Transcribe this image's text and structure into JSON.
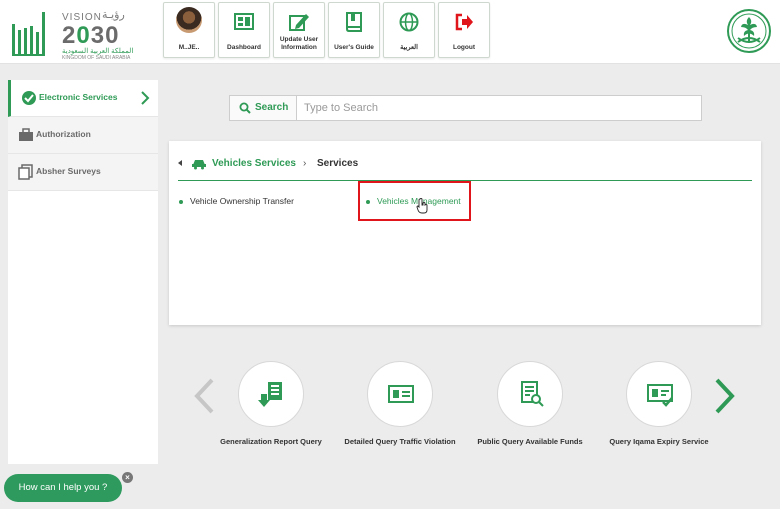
{
  "header": {
    "logo": {
      "vision": "VISION",
      "vision_ar": "رؤيـة",
      "year_a": "2",
      "year_b": "0",
      "year_c": "30",
      "kingdom_ar": "المملكة العربية السعودية",
      "kingdom": "KINGDOM OF SAUDI ARABIA"
    },
    "nav": [
      {
        "label": "M..JE..",
        "icon": "avatar"
      },
      {
        "label": "Dashboard",
        "icon": "dashboard-icon"
      },
      {
        "label_line1": "Update User",
        "label_line2": "Information",
        "icon": "edit-icon"
      },
      {
        "label": "User's Guide",
        "icon": "book-icon"
      },
      {
        "label": "العربية",
        "icon": "globe-icon"
      },
      {
        "label": "Logout",
        "icon": "logout-icon"
      }
    ]
  },
  "sidebar": {
    "items": [
      {
        "label": "Electronic Services",
        "icon": "services-icon",
        "active": true
      },
      {
        "label": "Authorization",
        "icon": "briefcase-icon"
      },
      {
        "label": "Absher Surveys",
        "icon": "documents-icon"
      }
    ]
  },
  "search": {
    "button_label": "Search",
    "placeholder": "Type to Search"
  },
  "breadcrumb": {
    "parent": "Vehicles Services",
    "separator": "›",
    "current": "Services"
  },
  "services": [
    "Vehicle Ownership Transfer",
    "Vehicles Management"
  ],
  "quick_services": [
    {
      "label": "Generalization Report Query",
      "icon": "report-icon"
    },
    {
      "label": "Detailed Query Traffic Violation",
      "icon": "id-card-icon"
    },
    {
      "label": "Public Query Available Funds",
      "icon": "document-search-icon"
    },
    {
      "label": "Query Iqama Expiry Service",
      "icon": "id-check-icon"
    }
  ],
  "chat": {
    "label": "How can I help you ?",
    "close": "×"
  },
  "colors": {
    "brand_green": "#2e9a55",
    "highlight_red": "#e0151b",
    "background": "#ececec"
  }
}
